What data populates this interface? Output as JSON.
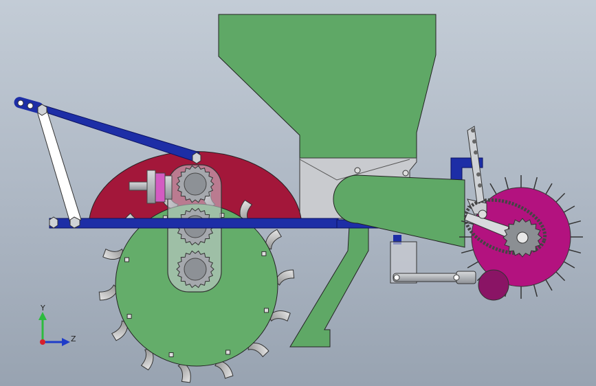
{
  "triad": {
    "y_label": "Y",
    "z_label": "Z",
    "y_color": "#2dbb3f",
    "z_color": "#1f3cc9",
    "origin_color": "#d8202c"
  },
  "colors": {
    "hopper": "#5fa866",
    "drum": "#a3173a",
    "seed_wheel": "#64ad6a",
    "frame": "#1d2ea6",
    "press_wheel": "#b3127f",
    "sprocket": "#8b8f93",
    "chute": "#5fa866",
    "link_bar": "#ffffff"
  }
}
